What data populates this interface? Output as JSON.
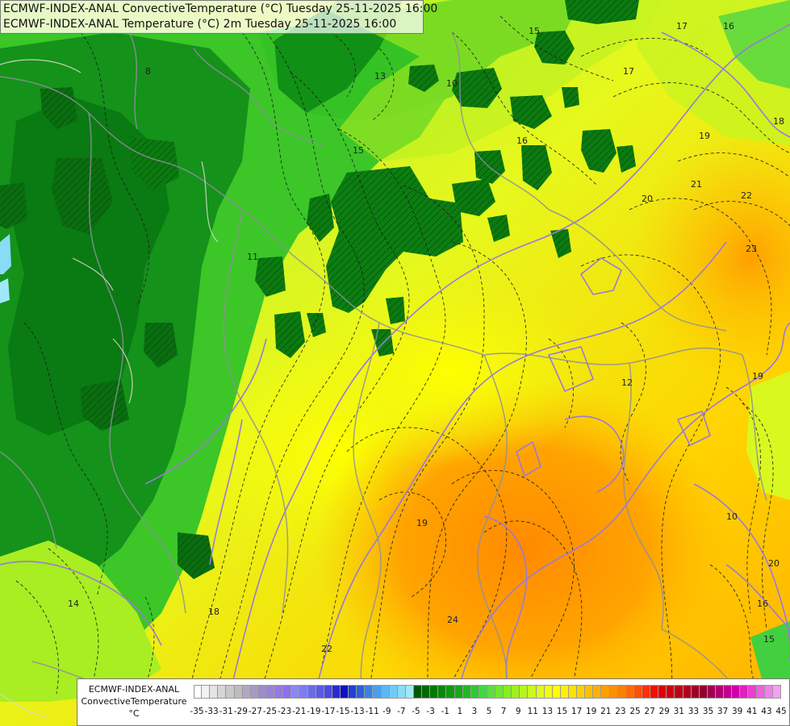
{
  "titles": {
    "line1": "ECMWF-INDEX-ANAL ConvectiveTemperature (°C) Tuesday 25-11-2025 16:00",
    "line2": "ECMWF-INDEX-ANAL Temperature (°C) 2m Tuesday 25-11-2025 16:00"
  },
  "legend": {
    "model": "ECMWF-INDEX-ANAL",
    "parameter": "ConvectiveTemperature",
    "unit": "°C",
    "tick_labels": [
      "-35",
      "-33",
      "-31",
      "-29",
      "-27",
      "-25",
      "-23",
      "-21",
      "-19",
      "-17",
      "-15",
      "-13",
      "-11",
      "-9",
      "-7",
      "-5",
      "-3",
      "-1",
      "1",
      "3",
      "5",
      "7",
      "9",
      "11",
      "13",
      "15",
      "17",
      "19",
      "21",
      "23",
      "25",
      "27",
      "29",
      "31",
      "33",
      "35",
      "37",
      "39",
      "41",
      "43",
      "45"
    ],
    "colors": [
      "#ffffff",
      "#f2f2f2",
      "#e4e4e4",
      "#d6d6d6",
      "#c8c8c8",
      "#bcbcbc",
      "#b0a8c0",
      "#a69ac8",
      "#9c8cd0",
      "#9a82dc",
      "#9478e6",
      "#8c70ee",
      "#8a88f4",
      "#7c7cf0",
      "#6a6aea",
      "#5a5ae4",
      "#4a4ade",
      "#2a2ad0",
      "#1010c0",
      "#2040d0",
      "#2a60dc",
      "#3a80e4",
      "#4aa0ec",
      "#5ab8f2",
      "#70ccf4",
      "#88dcf6",
      "#a0e8f8",
      "#005800",
      "#006800",
      "#007800",
      "#088808",
      "#109810",
      "#18a818",
      "#20b820",
      "#30c830",
      "#40d840",
      "#58e040",
      "#70e830",
      "#88ee20",
      "#a0f020",
      "#b8f420",
      "#ccf820",
      "#e0fa20",
      "#f0fc10",
      "#ffff00",
      "#fff000",
      "#ffe000",
      "#ffd000",
      "#ffc000",
      "#ffb000",
      "#ffa000",
      "#ff9000",
      "#ff8000",
      "#ff6a00",
      "#ff5000",
      "#ff3000",
      "#f01000",
      "#e00000",
      "#d00010",
      "#c00018",
      "#b00020",
      "#a00028",
      "#900030",
      "#a00050",
      "#b00070",
      "#c00090",
      "#d000a8",
      "#e020c0",
      "#e840d0",
      "#f060e0",
      "#f080ea",
      "#f4a0f2"
    ],
    "pointer": "25"
  },
  "contour_labels": [
    "15",
    "16",
    "17",
    "13",
    "10",
    "8",
    "15",
    "16",
    "17",
    "18",
    "19",
    "20",
    "21",
    "22",
    "23",
    "11",
    "12",
    "19",
    "20",
    "10",
    "16",
    "15",
    "19",
    "18",
    "22",
    "24",
    "14"
  ]
}
